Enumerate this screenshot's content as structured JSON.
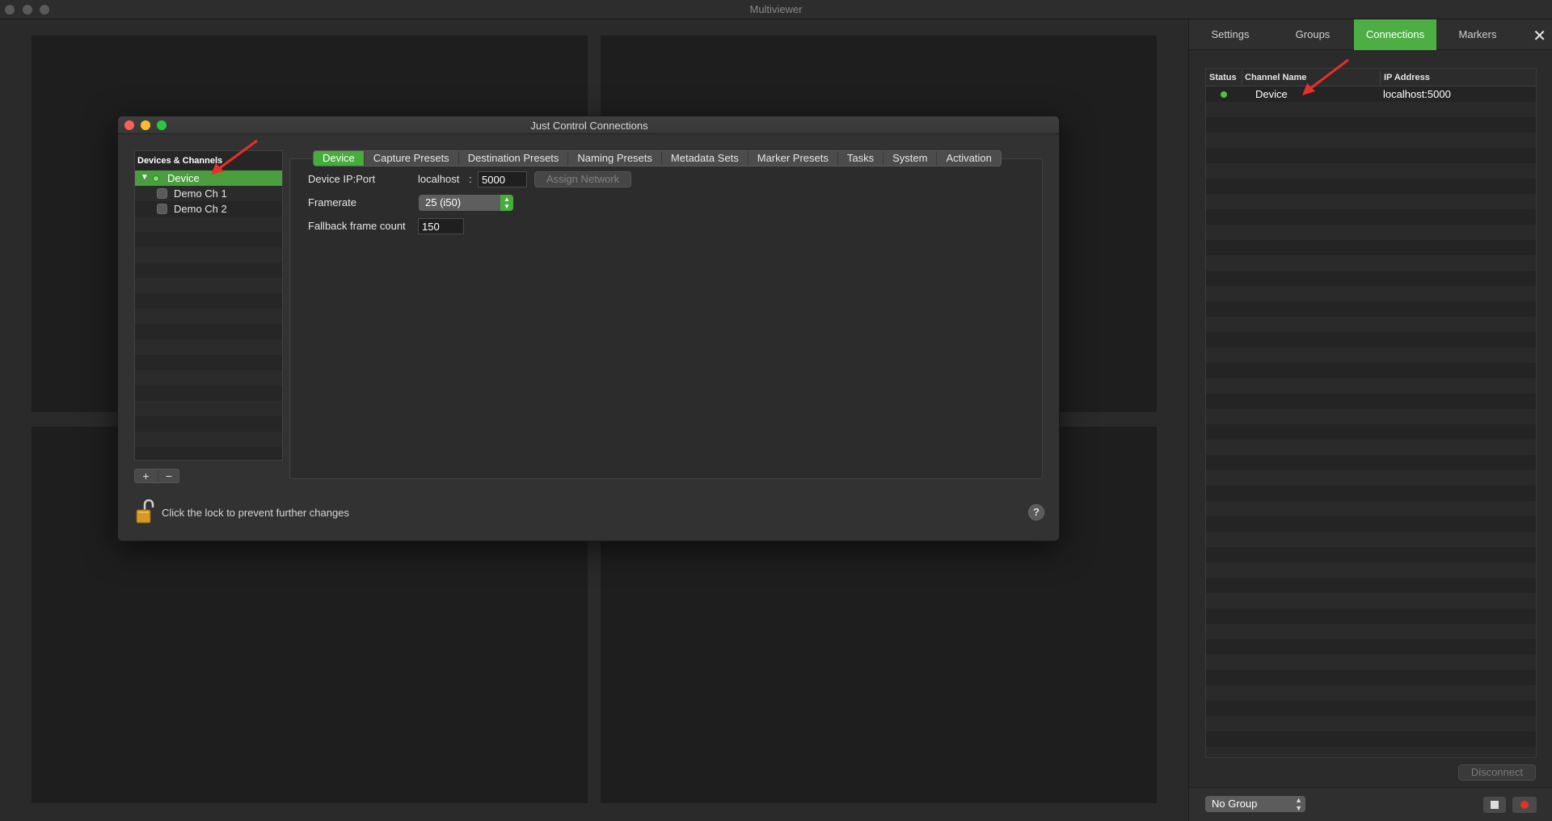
{
  "window": {
    "title": "Multiviewer"
  },
  "panel": {
    "tabs": [
      "Settings",
      "Groups",
      "Connections",
      "Markers"
    ],
    "active_tab": "Connections",
    "table": {
      "headers": [
        "Status",
        "Channel Name",
        "IP Address"
      ],
      "rows": [
        {
          "status": "connected",
          "channel": "Device",
          "ip": "localhost:5000"
        }
      ]
    },
    "disconnect_label": "Disconnect",
    "group_select": "No Group"
  },
  "dialog": {
    "title": "Just Control Connections",
    "list_header": "Devices & Channels",
    "device": "Device",
    "channels": [
      "Demo Ch 1",
      "Demo Ch 2"
    ],
    "plus_label": "+",
    "minus_label": "−",
    "tabs": [
      "Device",
      "Capture Presets",
      "Destination Presets",
      "Naming Presets",
      "Metadata Sets",
      "Marker Presets",
      "Tasks",
      "System",
      "Activation"
    ],
    "active_tab": "Device",
    "fields": {
      "ip_label": "Device IP:Port",
      "host": "localhost",
      "colon": ":",
      "port": "5000",
      "assign_label": "Assign Network",
      "framerate_label": "Framerate",
      "framerate_value": "25 (i50)",
      "fallback_label": "Fallback frame count",
      "fallback_value": "150"
    },
    "lock_text": "Click the lock to prevent further changes",
    "help_label": "?"
  },
  "colors": {
    "accent_green": "#45ad3a",
    "status_green": "#4fc13f",
    "record_red": "#e0342b"
  },
  "icons": [
    "close-icon",
    "lock-icon",
    "help-icon",
    "disclosure-triangle-icon",
    "stop-icon",
    "record-icon",
    "arrow-annotation-icon"
  ]
}
